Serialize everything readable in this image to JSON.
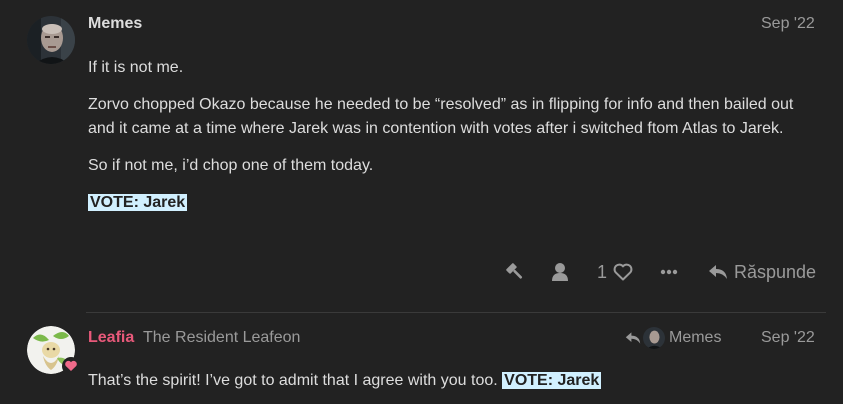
{
  "posts": [
    {
      "username": "Memes",
      "date": "Sep '22",
      "paragraphs": [
        "If it is not me.",
        "Zorvo chopped Okazo because he needed to be “resolved” as in flipping for info and then bailed out and it came at a time where Jarek was in contention with votes after i switched ftom Atlas to Jarek.",
        "So if not me, i’d chop one of them today."
      ],
      "vote": "VOTE: Jarek",
      "actions": {
        "like_count": "1",
        "reply_label": "Răspunde"
      }
    },
    {
      "username": "Leafia",
      "user_title": "The Resident Leafeon",
      "reply_to": "Memes",
      "date": "Sep '22",
      "text": "That’s the spirit! I’ve got to admit that I agree with you too.",
      "vote": "VOTE: Jarek"
    }
  ],
  "icons": {
    "flag": "gavel-icon",
    "user": "user-icon",
    "like": "heart-icon",
    "more": "ellipsis-icon",
    "reply": "reply-arrow-icon",
    "badge": "heart-badge-icon"
  },
  "colors": {
    "background": "#222222",
    "text": "#dddddd",
    "muted": "#9a9a9a",
    "leafia_name": "#e8597a",
    "vote_highlight": "#d1f0ff"
  }
}
